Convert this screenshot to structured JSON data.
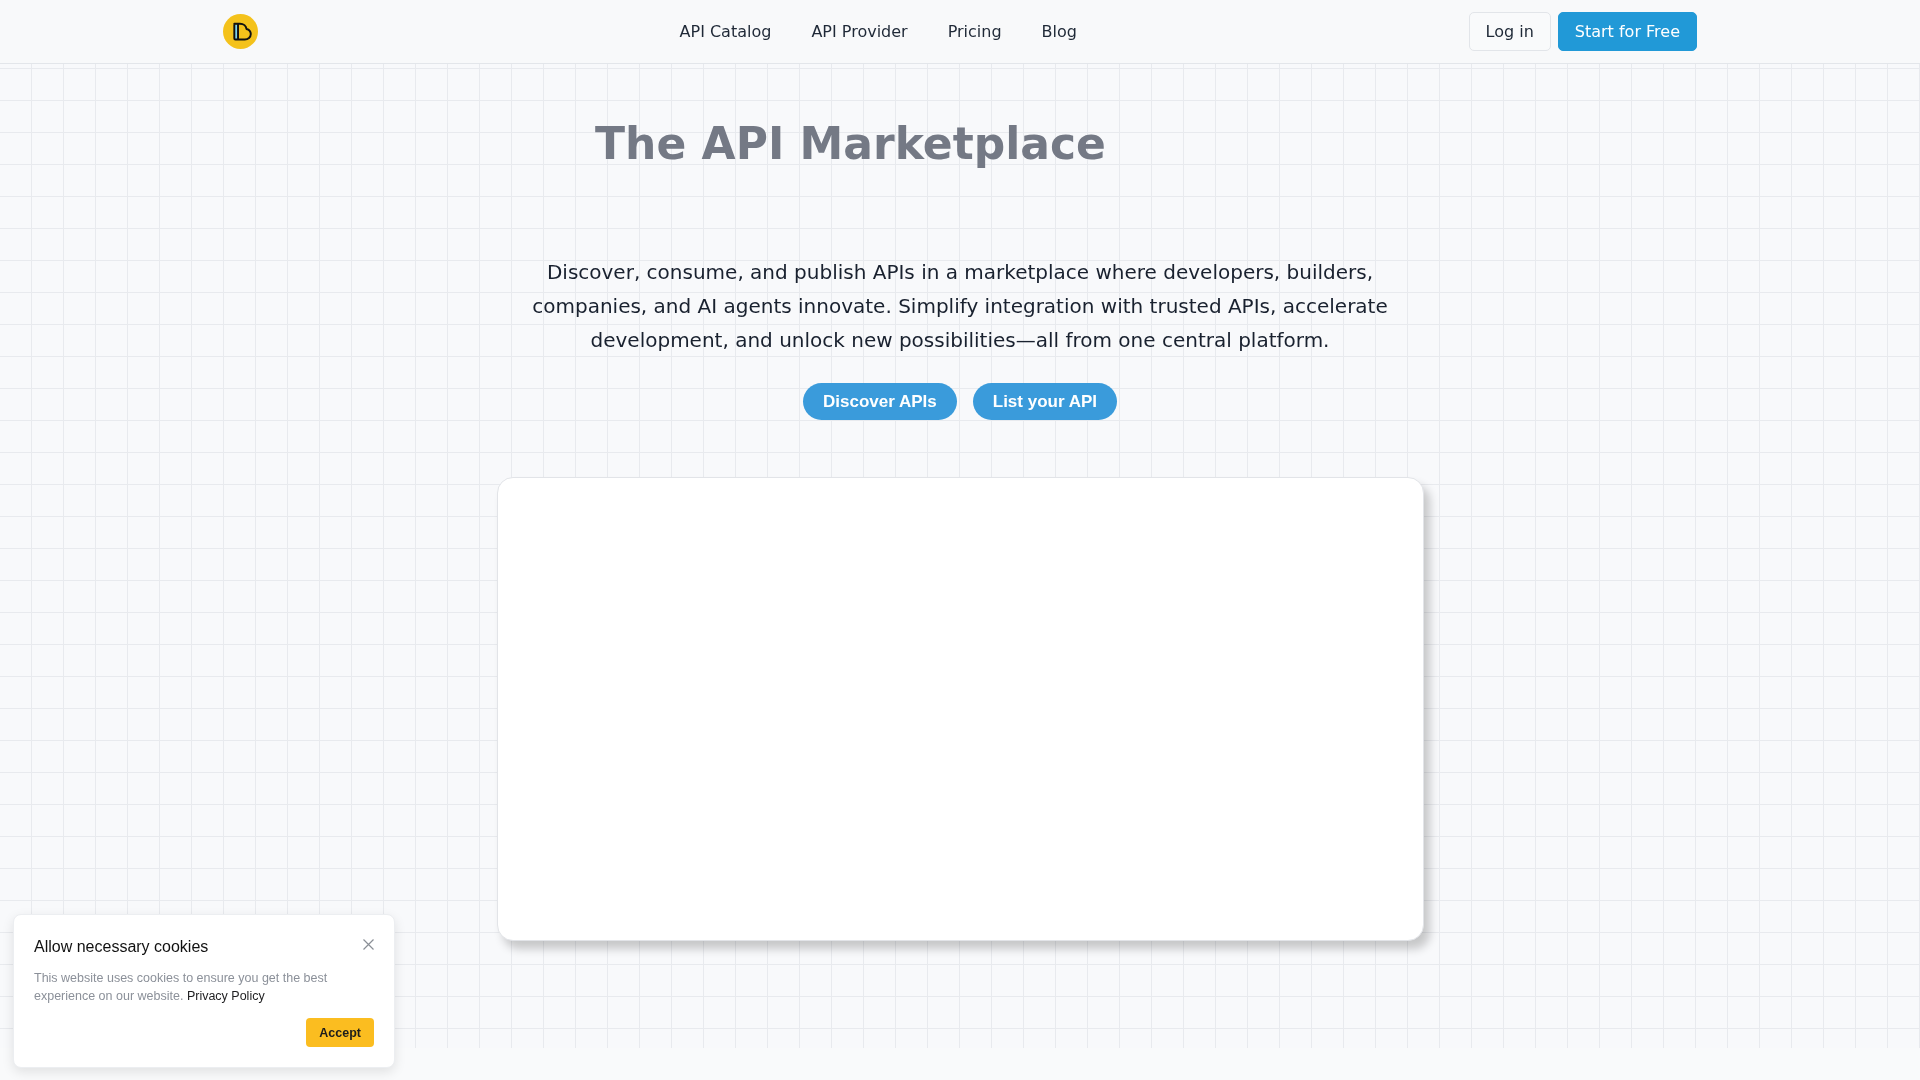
{
  "header": {
    "nav": [
      {
        "label": "API Catalog"
      },
      {
        "label": "API Provider"
      },
      {
        "label": "Pricing"
      },
      {
        "label": "Blog"
      }
    ],
    "actions": [
      {
        "label": "Log in",
        "kind": "secondary"
      },
      {
        "label": "Start for Free",
        "kind": "primary"
      }
    ]
  },
  "hero": {
    "title": "The API Marketplace",
    "description": "Discover, consume, and publish APIs in a marketplace where developers, builders, companies, and AI agents innovate. Simplify integration with trusted APIs, accelerate development, and unlock new possibilities—all from one central platform.",
    "buttons": [
      {
        "label": "Discover APIs"
      },
      {
        "label": "List your API"
      }
    ]
  },
  "cookie_banner": {
    "title": "Allow necessary cookies",
    "message": "This website uses cookies to ensure you get the best experience on our website.",
    "link": "Privacy Policy",
    "button": "Accept"
  }
}
